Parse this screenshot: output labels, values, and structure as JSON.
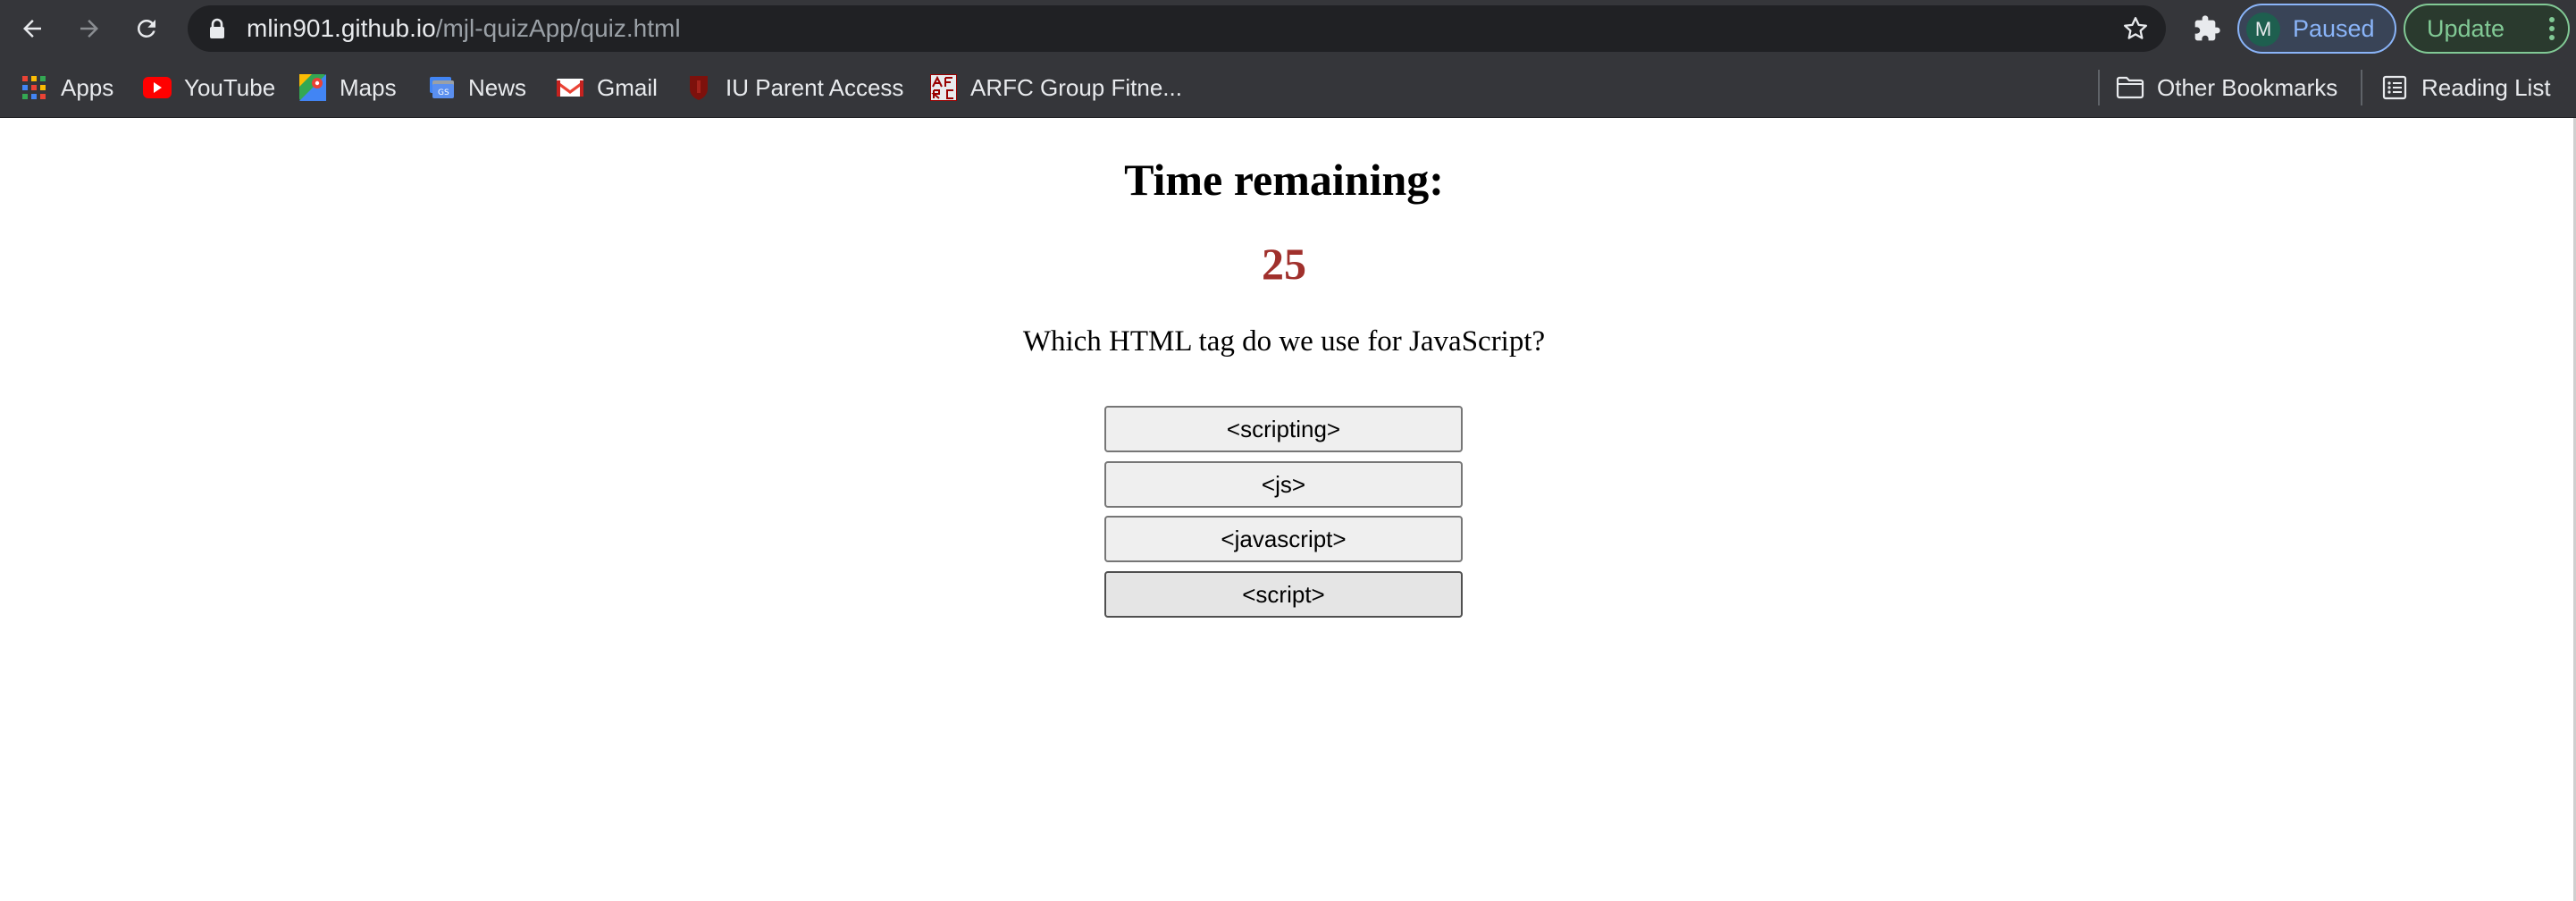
{
  "browser": {
    "url_host": "mlin901.github.io",
    "url_path": "/mjl-quizApp/quiz.html",
    "profile_initial": "M",
    "profile_label": "Paused",
    "update_label": "Update"
  },
  "bookmarks": {
    "items": [
      {
        "label": "Apps",
        "icon": "apps-grid-icon"
      },
      {
        "label": "YouTube",
        "icon": "youtube-icon"
      },
      {
        "label": "Maps",
        "icon": "maps-icon"
      },
      {
        "label": "News",
        "icon": "news-icon"
      },
      {
        "label": "Gmail",
        "icon": "gmail-icon"
      },
      {
        "label": "IU Parent Access",
        "icon": "iu-icon"
      },
      {
        "label": "ARFC Group Fitne...",
        "icon": "arfc-icon"
      }
    ],
    "other_bookmarks": "Other Bookmarks",
    "reading_list": "Reading List"
  },
  "quiz": {
    "heading": "Time remaining:",
    "timer": "25",
    "question": "Which HTML tag do we use for JavaScript?",
    "choices": [
      "<scripting>",
      "<js>",
      "<javascript>",
      "<script>"
    ]
  },
  "colors": {
    "chrome_bg": "#35363a",
    "omnibox_bg": "#202124",
    "timer_color": "#a0302c",
    "button_bg": "#efefef"
  }
}
